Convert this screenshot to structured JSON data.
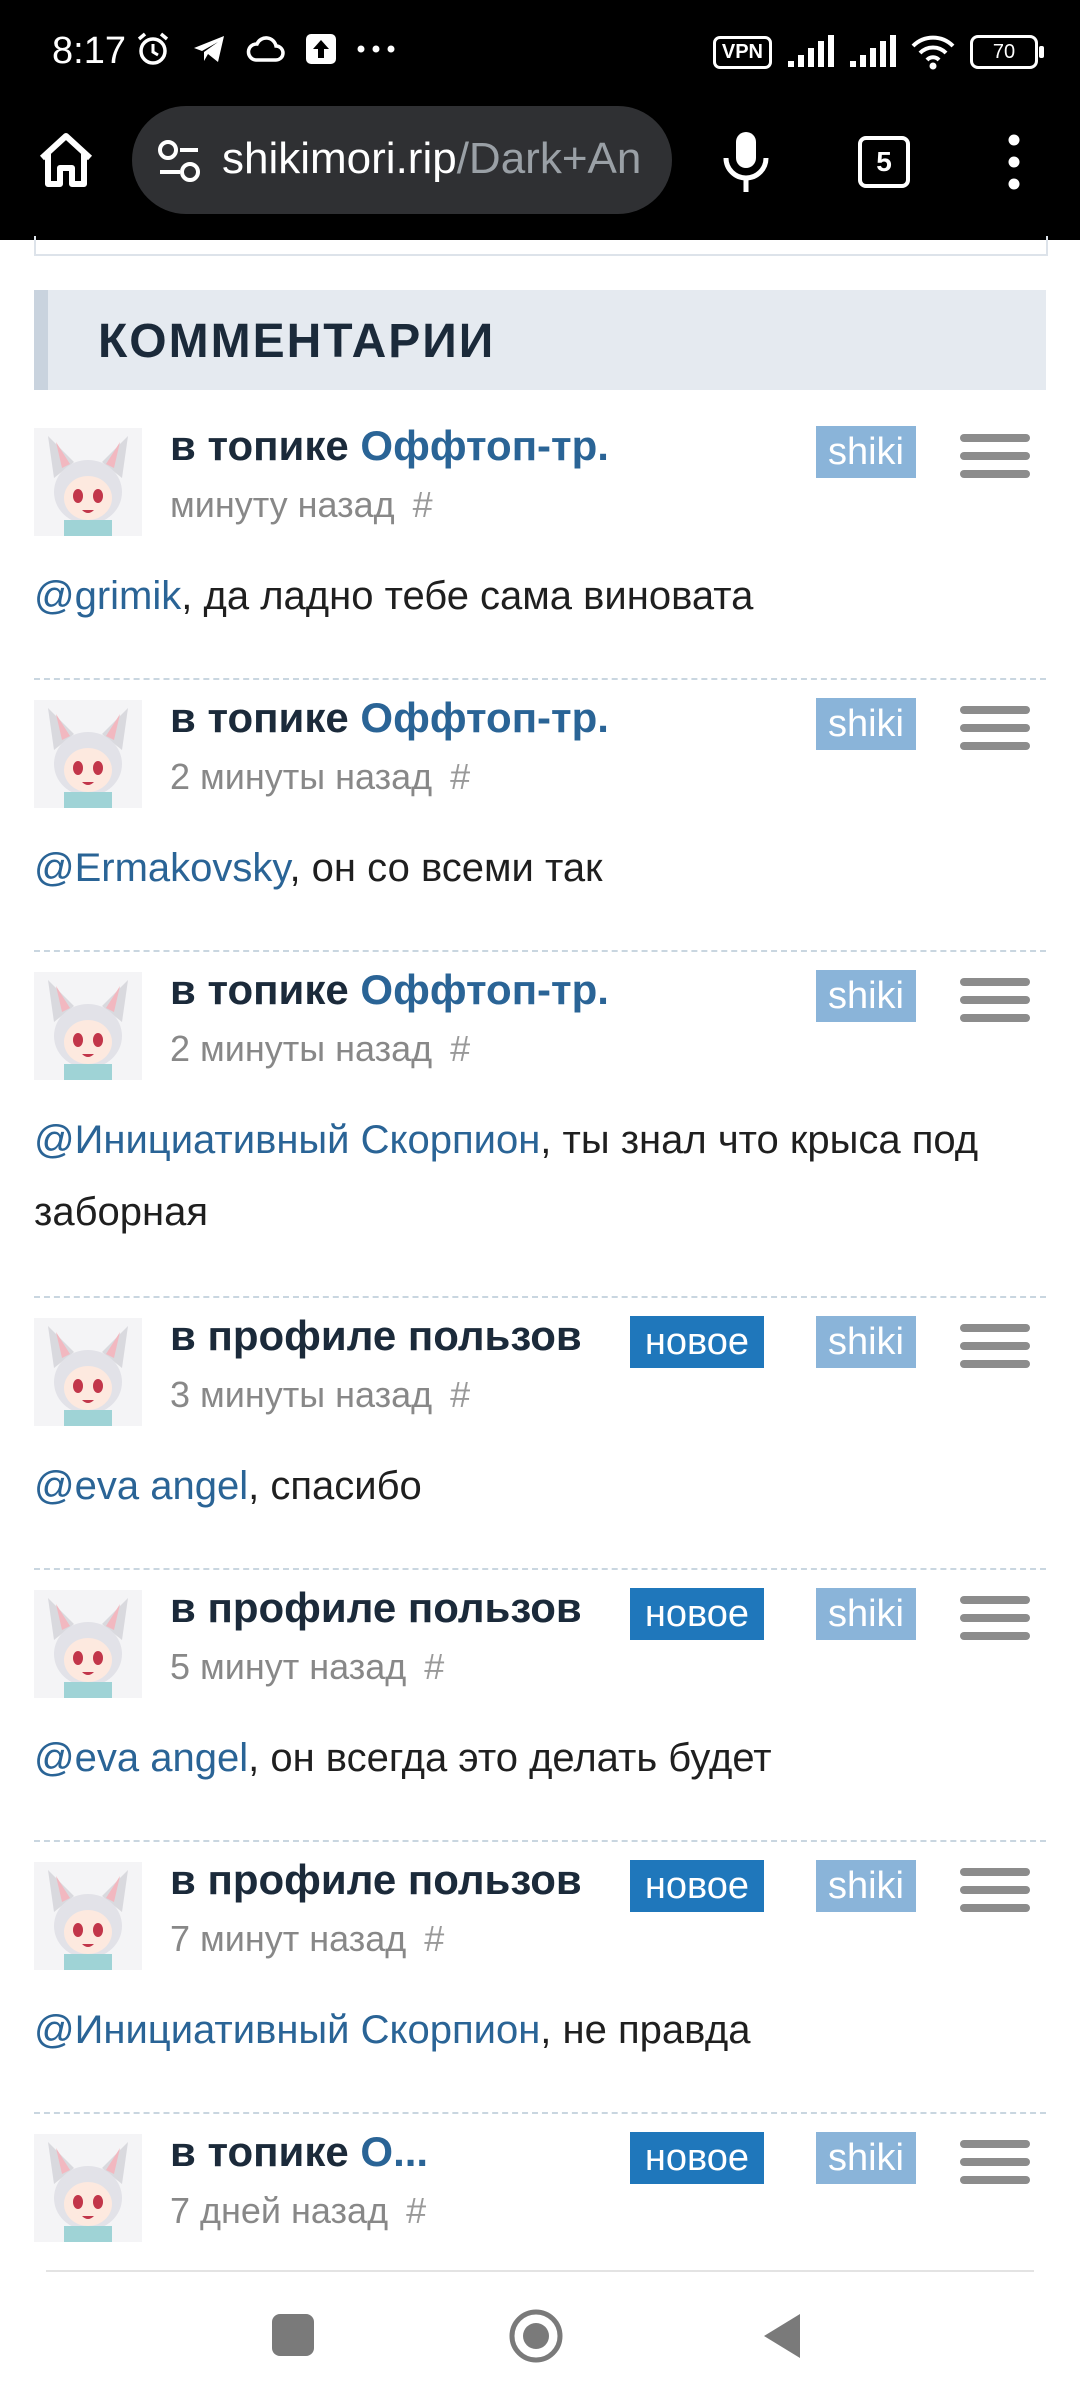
{
  "status_bar": {
    "time": "8:17",
    "vpn": "VPN",
    "battery": "70"
  },
  "browser": {
    "url_host": "shikimori.rip",
    "url_path": "/Dark+An",
    "tab_count": "5"
  },
  "section": {
    "title": "КОММЕНТАРИИ"
  },
  "comments": [
    {
      "prefix": "в топике ",
      "link": "Оффтоп-тр...",
      "time": "минуту назад",
      "hash": "#",
      "badge_new": "",
      "badge_shiki": "shiki",
      "mention": "@grimik",
      "text": ", да ладно тебе сама виновата"
    },
    {
      "prefix": "в топике ",
      "link": "Оффтоп-тр...",
      "time": "2 минуты назад",
      "hash": "#",
      "badge_new": "",
      "badge_shiki": "shiki",
      "mention": "@Ermakovsky",
      "text": ", он со всеми так"
    },
    {
      "prefix": "в топике ",
      "link": "Оффтоп-тр...",
      "time": "2 минуты назад",
      "hash": "#",
      "badge_new": "",
      "badge_shiki": "shiki",
      "mention": "@Инициативный Скорпион",
      "text": ", ты знал что крыса под заборная"
    },
    {
      "prefix": "в профиле пользова",
      "link": "",
      "time": "3 минуты назад",
      "hash": "#",
      "badge_new": "новое",
      "badge_shiki": "shiki",
      "mention": "@eva angel",
      "text": ", спасибо"
    },
    {
      "prefix": "в профиле пользова",
      "link": "",
      "time": "5 минут назад",
      "hash": "#",
      "badge_new": "новое",
      "badge_shiki": "shiki",
      "mention": "@eva angel",
      "text": ", он всегда это делать будет"
    },
    {
      "prefix": "в профиле пользова",
      "link": "",
      "time": "7 минут назад",
      "hash": "#",
      "badge_new": "новое",
      "badge_shiki": "shiki",
      "mention": "@Инициативный Скорпион",
      "text": ", не правда"
    },
    {
      "prefix": "в топике ",
      "link": "О...",
      "time": "7 дней назад",
      "hash": "#",
      "badge_new": "новое",
      "badge_shiki": "shiki",
      "mention": "",
      "text": ""
    }
  ],
  "colors": {
    "link": "#2a6496",
    "badge_new": "#1f77bb",
    "badge_shiki": "#8ab4d9",
    "header_bg": "#e5eaf0"
  }
}
